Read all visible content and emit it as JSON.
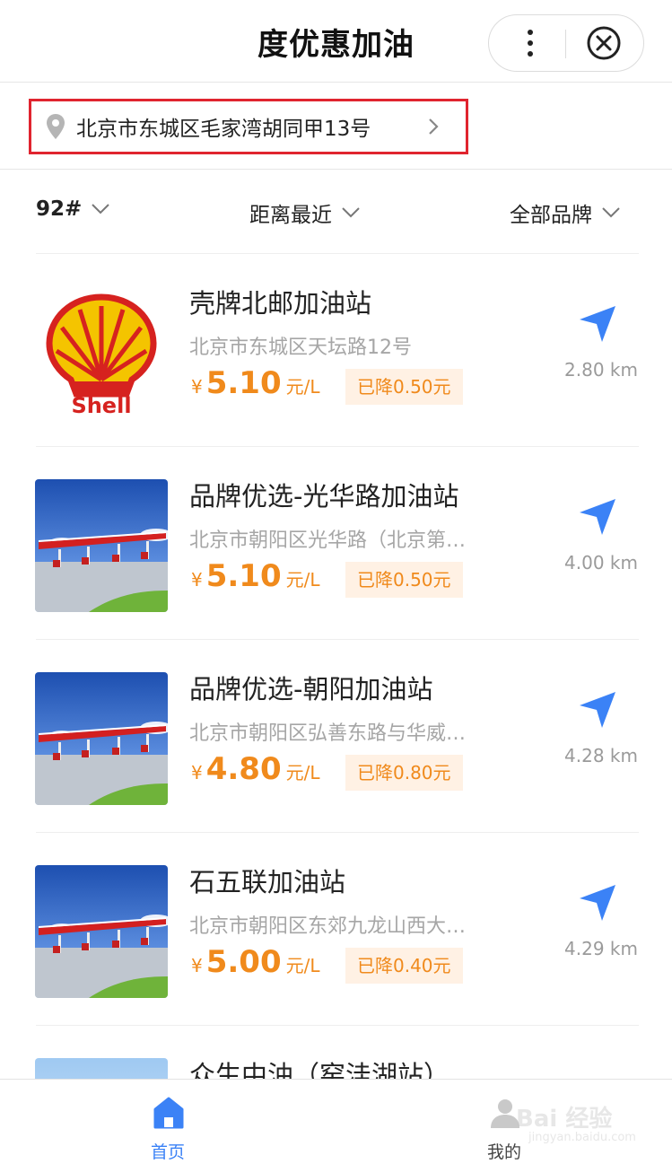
{
  "header": {
    "title": "度优惠加油"
  },
  "location": {
    "address": "北京市东城区毛家湾胡同甲13号"
  },
  "filters": {
    "fuel": "92#",
    "sort": "距离最近",
    "brand": "全部品牌"
  },
  "stations": [
    {
      "name": "壳牌北邮加油站",
      "address": "北京市东城区天坛路12号",
      "currency": "¥",
      "price": "5.10",
      "unit": "元/L",
      "discount": "已降0.50元",
      "distance": "2.80 km",
      "logo_text": "Shell"
    },
    {
      "name": "品牌优选-光华路加油站",
      "address": "北京市朝阳区光华路（北京第…",
      "currency": "¥",
      "price": "5.10",
      "unit": "元/L",
      "discount": "已降0.50元",
      "distance": "4.00 km"
    },
    {
      "name": "品牌优选-朝阳加油站",
      "address": "北京市朝阳区弘善东路与华威…",
      "currency": "¥",
      "price": "4.80",
      "unit": "元/L",
      "discount": "已降0.80元",
      "distance": "4.28 km"
    },
    {
      "name": "石五联加油站",
      "address": "北京市朝阳区东郊九龙山西大…",
      "currency": "¥",
      "price": "5.00",
      "unit": "元/L",
      "discount": "已降0.40元",
      "distance": "4.29 km"
    },
    {
      "name": "众生中油（窑洼湖站）"
    }
  ],
  "tabs": [
    {
      "label": "首页",
      "icon": "home-icon",
      "active": true
    },
    {
      "label": "我的",
      "icon": "user-icon",
      "active": false
    }
  ],
  "watermark": {
    "line1": "Bai 经验",
    "line2": "jingyan.baidu.com"
  },
  "colors": {
    "accent_orange": "#f08a1c",
    "discount_bg": "#fff1e4",
    "nav_blue": "#3b82f6",
    "highlight_red": "#e0242f"
  }
}
